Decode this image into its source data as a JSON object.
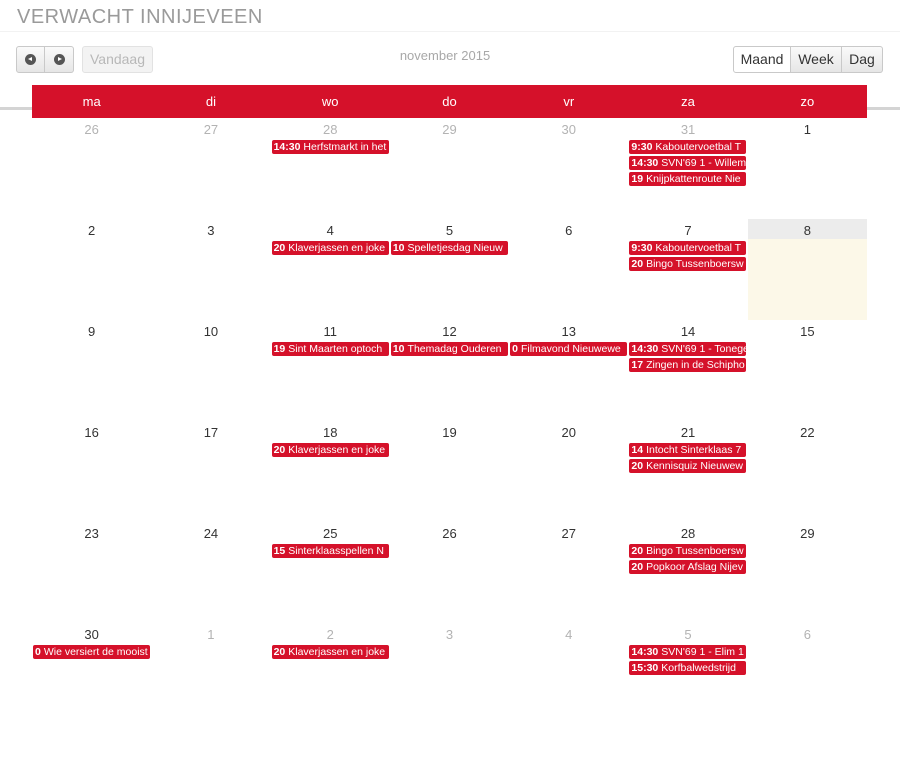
{
  "page": {
    "title": "VERWACHT INNIJEVEEN"
  },
  "toolbar": {
    "prev_icon": "chevron-left-circle-icon",
    "next_icon": "chevron-right-circle-icon",
    "today_label": "Vandaag",
    "month_label": "november 2015",
    "views": [
      "Maand",
      "Week",
      "Dag"
    ],
    "active_view": "Maand"
  },
  "colors": {
    "accent": "#d5112a",
    "today_bg": "#fcf8e8"
  },
  "calendar": {
    "weekdays": [
      "ma",
      "di",
      "wo",
      "do",
      "vr",
      "za",
      "zo"
    ],
    "weeks": [
      [
        {
          "day": "26",
          "other": true,
          "events": []
        },
        {
          "day": "27",
          "other": true,
          "events": []
        },
        {
          "day": "28",
          "other": true,
          "events": [
            {
              "time": "14:30",
              "title": "Herfstmarkt in het"
            }
          ]
        },
        {
          "day": "29",
          "other": true,
          "events": []
        },
        {
          "day": "30",
          "other": true,
          "events": []
        },
        {
          "day": "31",
          "other": true,
          "events": [
            {
              "time": "9:30",
              "title": "Kaboutervoetbal T"
            },
            {
              "time": "14:30",
              "title": "SVN'69 1 - Willem"
            },
            {
              "time": "19",
              "title": "Knijpkattenroute Nie"
            }
          ]
        },
        {
          "day": "1",
          "other": false,
          "events": []
        }
      ],
      [
        {
          "day": "2",
          "other": false,
          "events": []
        },
        {
          "day": "3",
          "other": false,
          "events": []
        },
        {
          "day": "4",
          "other": false,
          "events": [
            {
              "time": "20",
              "title": "Klaverjassen en joke"
            }
          ]
        },
        {
          "day": "5",
          "other": false,
          "events": [
            {
              "time": "10",
              "title": "Spelletjesdag Nieuw"
            }
          ]
        },
        {
          "day": "6",
          "other": false,
          "events": []
        },
        {
          "day": "7",
          "other": false,
          "events": [
            {
              "time": "9:30",
              "title": "Kaboutervoetbal T"
            },
            {
              "time": "20",
              "title": "Bingo Tussenboersw"
            }
          ]
        },
        {
          "day": "8",
          "other": false,
          "today": true,
          "events": []
        }
      ],
      [
        {
          "day": "9",
          "other": false,
          "events": []
        },
        {
          "day": "10",
          "other": false,
          "events": []
        },
        {
          "day": "11",
          "other": false,
          "events": [
            {
              "time": "19",
              "title": "Sint Maarten optoch"
            }
          ]
        },
        {
          "day": "12",
          "other": false,
          "events": [
            {
              "time": "10",
              "title": "Themadag Ouderen"
            }
          ]
        },
        {
          "day": "13",
          "other": false,
          "events": [
            {
              "time": "0",
              "title": "Filmavond Nieuwewe"
            }
          ]
        },
        {
          "day": "14",
          "other": false,
          "events": [
            {
              "time": "14:30",
              "title": "SVN'69 1 - Tonege"
            },
            {
              "time": "17",
              "title": "Zingen in de Schipho"
            }
          ]
        },
        {
          "day": "15",
          "other": false,
          "events": []
        }
      ],
      [
        {
          "day": "16",
          "other": false,
          "events": []
        },
        {
          "day": "17",
          "other": false,
          "events": []
        },
        {
          "day": "18",
          "other": false,
          "events": [
            {
              "time": "20",
              "title": "Klaverjassen en joke"
            }
          ]
        },
        {
          "day": "19",
          "other": false,
          "events": []
        },
        {
          "day": "20",
          "other": false,
          "events": []
        },
        {
          "day": "21",
          "other": false,
          "events": [
            {
              "time": "14",
              "title": "Intocht Sinterklaas 7"
            },
            {
              "time": "20",
              "title": "Kennisquiz Nieuwew"
            }
          ]
        },
        {
          "day": "22",
          "other": false,
          "events": []
        }
      ],
      [
        {
          "day": "23",
          "other": false,
          "events": []
        },
        {
          "day": "24",
          "other": false,
          "events": []
        },
        {
          "day": "25",
          "other": false,
          "events": [
            {
              "time": "15",
              "title": "Sinterklaasspellen N"
            }
          ]
        },
        {
          "day": "26",
          "other": false,
          "events": []
        },
        {
          "day": "27",
          "other": false,
          "events": []
        },
        {
          "day": "28",
          "other": false,
          "events": [
            {
              "time": "20",
              "title": "Bingo Tussenboersw"
            },
            {
              "time": "20",
              "title": "Popkoor Afslag Nijev"
            }
          ]
        },
        {
          "day": "29",
          "other": false,
          "events": []
        }
      ],
      [
        {
          "day": "30",
          "other": false,
          "events": [
            {
              "time": "0",
              "title": "Wie versiert de mooist"
            }
          ]
        },
        {
          "day": "1",
          "other": true,
          "events": []
        },
        {
          "day": "2",
          "other": true,
          "events": [
            {
              "time": "20",
              "title": "Klaverjassen en joke"
            }
          ]
        },
        {
          "day": "3",
          "other": true,
          "events": []
        },
        {
          "day": "4",
          "other": true,
          "events": []
        },
        {
          "day": "5",
          "other": true,
          "events": [
            {
              "time": "14:30",
              "title": "SVN'69 1 - Elim 1"
            },
            {
              "time": "15:30",
              "title": "Korfbalwedstrijd"
            }
          ]
        },
        {
          "day": "6",
          "other": true,
          "events": []
        }
      ]
    ]
  }
}
